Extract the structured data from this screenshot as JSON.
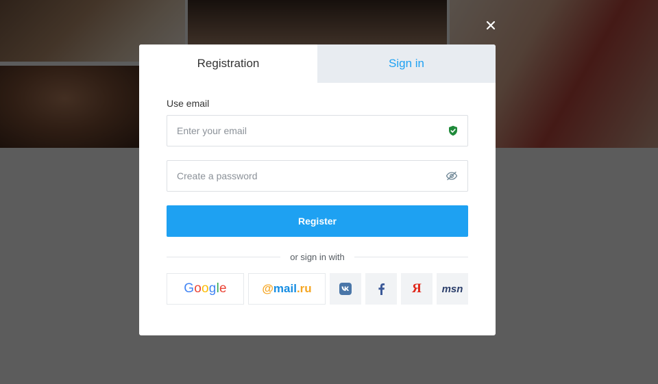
{
  "close": {
    "icon": "close-icon"
  },
  "tabs": {
    "registration": "Registration",
    "sign_in": "Sign in",
    "active": "registration"
  },
  "form": {
    "use_email_label": "Use email",
    "email": {
      "value": "",
      "placeholder": "Enter your email",
      "icon": "shield-check-icon"
    },
    "password": {
      "value": "",
      "placeholder": "Create a password",
      "icon": "eye-hidden-icon"
    },
    "register_label": "Register"
  },
  "social": {
    "divider_text": "or sign in with",
    "providers": [
      {
        "id": "google",
        "label": "Google"
      },
      {
        "id": "mailru",
        "label": "@mail.ru"
      },
      {
        "id": "vk",
        "label": "vk",
        "icon": "vk-icon"
      },
      {
        "id": "facebook",
        "label": "f",
        "icon": "facebook-icon"
      },
      {
        "id": "yandex",
        "label": "Я",
        "icon": "yandex-icon"
      },
      {
        "id": "msn",
        "label": "msn",
        "icon": "msn-icon"
      }
    ]
  },
  "colors": {
    "accent": "#1ea1f2",
    "shield": "#1f8a3a",
    "overlay": "rgba(0,0,0,0.62)",
    "tab_inactive_bg": "#e8ecf1"
  }
}
